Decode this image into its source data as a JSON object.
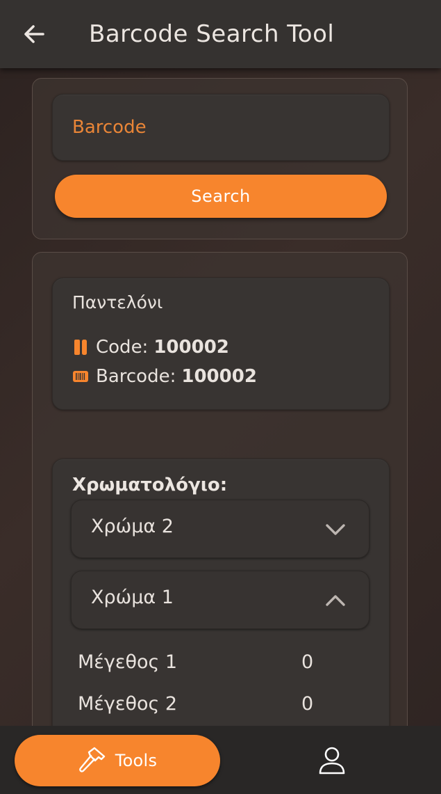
{
  "appbar": {
    "title": "Barcode Search Tool",
    "back_icon": "arrow-left-icon"
  },
  "search": {
    "placeholder": "Barcode",
    "value": "",
    "button_label": "Search"
  },
  "product": {
    "name": "Παντελόνι",
    "code_label": "Code:",
    "code_value": "100002",
    "code_icon": "tag-icon",
    "barcode_label": "Barcode:",
    "barcode_value": "100002",
    "barcode_icon": "barcode-icon"
  },
  "colors": {
    "title": "Χρωματολόγιο:",
    "items": [
      {
        "label": "Χρώμα 2",
        "expanded": false
      },
      {
        "label": "Χρώμα 1",
        "expanded": true
      }
    ],
    "sizes": [
      {
        "label": "Μέγεθος 1",
        "qty": "0"
      },
      {
        "label": "Μέγεθος 2",
        "qty": "0"
      }
    ]
  },
  "nav": {
    "tools_label": "Tools",
    "tools_icon": "hammer-icon",
    "profile_icon": "person-icon"
  },
  "theme": {
    "accent": "#f7852d",
    "surface": "#383432",
    "appbar": "#353230"
  }
}
